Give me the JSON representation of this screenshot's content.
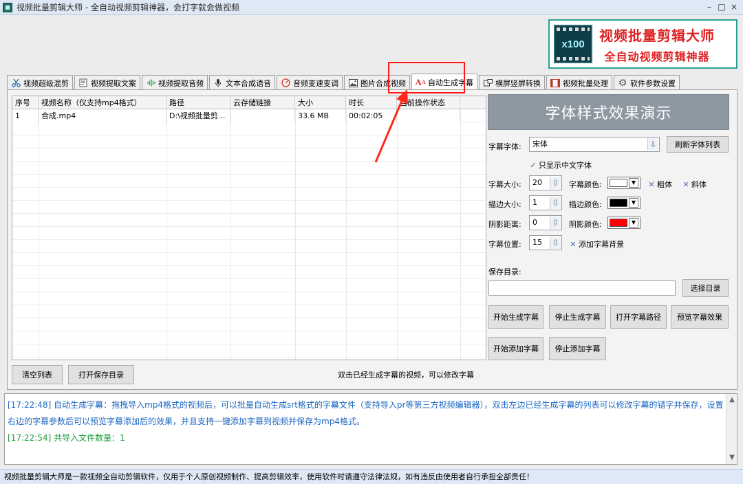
{
  "window": {
    "title": "视频批量剪辑大师 - 全自动视频剪辑神器，会打字就会做视频",
    "controls": [
      "–",
      "□",
      "×"
    ]
  },
  "banner": {
    "logo_text": "x100",
    "line1": "视频批量剪辑大师",
    "line2": "全自动视频剪辑神器"
  },
  "tabs": [
    {
      "label": "视频超级混剪",
      "icon": "scissors-icon"
    },
    {
      "label": "视频提取文案",
      "icon": "document-icon"
    },
    {
      "label": "视频提取音频",
      "icon": "audio-wave-icon"
    },
    {
      "label": "文本合成语音",
      "icon": "microphone-icon"
    },
    {
      "label": "音频变速变调",
      "icon": "gauge-icon"
    },
    {
      "label": "图片合成视频",
      "icon": "image-icon"
    },
    {
      "label": "自动生成字幕",
      "icon": "subtitle-icon",
      "active": true
    },
    {
      "label": "横屏竖屏转换",
      "icon": "rotate-screen-icon"
    },
    {
      "label": "视频批量处理",
      "icon": "film-icon"
    },
    {
      "label": "软件参数设置",
      "icon": "gear-icon"
    }
  ],
  "table": {
    "columns": [
      "序号",
      "视频名称（仅支持mp4格式）",
      "路径",
      "云存储链接",
      "大小",
      "时长",
      "当前操作状态"
    ],
    "rows": [
      [
        "1",
        "合成.mp4",
        "D:\\视频批量剪...",
        "",
        "33.6 MB",
        "00:02:05",
        ""
      ]
    ]
  },
  "buttons": {
    "clear_list": "清空列表",
    "open_save_dir": "打开保存目录",
    "refresh_fonts": "刷新字体列表",
    "choose_dir": "选择目录",
    "start_generate": "开始生成字幕",
    "stop_generate": "停止生成字幕",
    "open_subtitle_path": "打开字幕路径",
    "preview_effect": "预览字幕效果",
    "start_add": "开始添加字幕",
    "stop_add": "停止添加字幕"
  },
  "hint": "双击已经生成字幕的视频，可以修改字幕",
  "settings": {
    "preview_title": "字体样式效果演示",
    "font_label": "字幕字体:",
    "font_value": "宋体",
    "only_chinese_fonts": "只显示中文字体",
    "size_label": "字幕大小:",
    "size_value": "20",
    "color_label": "字幕颜色:",
    "color_value": "#ffffff",
    "bold_label": "粗体",
    "italic_label": "斜体",
    "stroke_size_label": "描边大小:",
    "stroke_size_value": "1",
    "stroke_color_label": "描边颜色:",
    "stroke_color_value": "#000000",
    "shadow_distance_label": "阴影距离:",
    "shadow_distance_value": "0",
    "shadow_color_label": "阴影颜色:",
    "shadow_color_value": "#ff0000",
    "position_label": "字幕位置:",
    "position_value": "15",
    "add_bg_label": "添加字幕背景",
    "save_dir_label": "保存目录:",
    "save_dir_value": ""
  },
  "log": {
    "line1": "[17:22:48] 自动生成字幕：拖拽导入mp4格式的视频后，可以批量自动生成srt格式的字幕文件（支持导入pr等第三方视频编辑器），双击左边已经生成字幕的列表可以修改字幕的错字并保存，设置",
    "line2": "右边的字幕参数后可以预览字幕添加后的效果，并且支持一键添加字幕到视频并保存为mp4格式。",
    "line3": "[17:22:54] 共导入文件数量：1"
  },
  "status": "视频批量剪辑大师是一款视频全自动剪辑软件，仅用于个人原创视频制作、提高剪辑效率，使用软件时请遵守法律法规，如有违反由使用者自行承担全部责任！",
  "colors": {
    "accent_red": "#ff1a1a",
    "log_blue": "#1a66c2",
    "log_green": "#1e9b3c"
  }
}
